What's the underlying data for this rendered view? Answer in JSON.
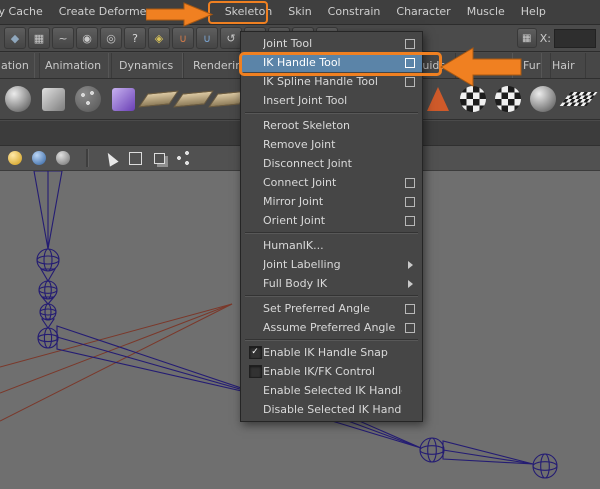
{
  "menu_bar": {
    "items": [
      {
        "label": "ry Cache"
      },
      {
        "label": "Create Deformers"
      },
      {
        "label": "Skeleton",
        "highlighted": true
      },
      {
        "label": "Skin"
      },
      {
        "label": "Constrain"
      },
      {
        "label": "Character"
      },
      {
        "label": "Muscle"
      },
      {
        "label": "Help"
      }
    ]
  },
  "status_line": {
    "coord_label": "X:",
    "coord_value": "",
    "icons": [
      {
        "name": "selection-mask-icon",
        "glyph": "◆",
        "color": "#8fa7bd"
      },
      {
        "name": "snap-grid-icon",
        "glyph": "▦",
        "color": "#c9c9c9"
      },
      {
        "name": "snap-curve-icon",
        "glyph": "~",
        "color": "#c9c9c9"
      },
      {
        "name": "snap-point-icon",
        "glyph": "◉",
        "color": "#c9c9c9"
      },
      {
        "name": "snap-view-icon",
        "glyph": "◎",
        "color": "#c9c9c9"
      },
      {
        "name": "help-icon",
        "glyph": "?",
        "color": "#d8d8d8"
      },
      {
        "name": "lock-icon",
        "glyph": "◈",
        "color": "#d8c35a"
      },
      {
        "name": "magnet-red-icon",
        "glyph": "∪",
        "color": "#d07a4a"
      },
      {
        "name": "magnet-blue-icon",
        "glyph": "∪",
        "color": "#7aa3cf"
      },
      {
        "name": "history-icon",
        "glyph": "↺",
        "color": "#c9c9c9"
      },
      {
        "name": "inputs-list-icon",
        "glyph": "≡",
        "color": "#c9c9c9"
      },
      {
        "name": "render-current-icon",
        "glyph": "▣",
        "color": "#c9c9c9"
      },
      {
        "name": "ipr-render-icon",
        "glyph": "▤",
        "color": "#c9c9c9"
      },
      {
        "name": "render-settings-icon",
        "glyph": "▥",
        "color": "#c9c9c9"
      }
    ]
  },
  "shelf": {
    "tabs": [
      "ation",
      "Animation",
      "Dynamics",
      "Rendering",
      "Fluids",
      "Fur",
      "Hair"
    ],
    "icons": [
      {
        "name": "polygon-sphere-icon",
        "type": "sphere"
      },
      {
        "name": "polygon-cube-icon",
        "type": "cube"
      },
      {
        "name": "particle-tool-icon",
        "type": "particles"
      },
      {
        "name": "polygon-cube-purple-icon",
        "type": "cube-purple"
      },
      {
        "name": "polygon-plane-icon",
        "type": "plane"
      },
      {
        "name": "polygon-plane-2-icon",
        "type": "plane"
      },
      {
        "name": "polygon-plane-3-icon",
        "type": "plane"
      },
      {
        "name": "sculpt-tool-icon",
        "type": "cursor"
      },
      {
        "name": "knife-tool-icon",
        "type": "knife"
      },
      {
        "name": "polygon-plane-4-icon",
        "type": "plane"
      },
      {
        "name": "polygon-plane-5-icon",
        "type": "plane"
      },
      {
        "name": "polygon-cone-icon",
        "type": "cone"
      },
      {
        "name": "joint-cone-icon",
        "type": "cone-red"
      },
      {
        "name": "checker-sphere-icon",
        "type": "checker-sphere"
      },
      {
        "name": "checker-sphere-2-icon",
        "type": "checker-sphere"
      },
      {
        "name": "texture-sphere-icon",
        "type": "sphere"
      },
      {
        "name": "checker-plane-icon",
        "type": "checker-plane"
      }
    ]
  },
  "panel_toolbar": {
    "icons": [
      {
        "name": "shaded-sphere-yellow-icon",
        "type": "sphere-yellow"
      },
      {
        "name": "shaded-sphere-blue-icon",
        "type": "sphere-blue"
      },
      {
        "name": "shaded-sphere-gray-icon",
        "type": "sphere-gray"
      },
      {
        "name": "toolbar-divider",
        "type": "sep"
      },
      {
        "name": "select-tool-icon",
        "type": "cursor"
      },
      {
        "name": "wireframe-cube-icon",
        "type": "cube"
      },
      {
        "name": "layers-icon",
        "type": "layers"
      },
      {
        "name": "connections-icon",
        "type": "share"
      }
    ]
  },
  "skeleton_menu": {
    "items": [
      {
        "label": "Joint Tool",
        "option_box": true
      },
      {
        "label": "IK Handle Tool",
        "option_box": true,
        "highlighted": true
      },
      {
        "label": "IK Spline Handle Tool",
        "option_box": true
      },
      {
        "label": "Insert Joint Tool"
      },
      {
        "separator": true
      },
      {
        "label": "Reroot Skeleton"
      },
      {
        "label": "Remove Joint"
      },
      {
        "label": "Disconnect Joint"
      },
      {
        "label": "Connect Joint",
        "option_box": true
      },
      {
        "label": "Mirror Joint",
        "option_box": true
      },
      {
        "label": "Orient Joint",
        "option_box": true
      },
      {
        "separator": true
      },
      {
        "label": "HumanIK..."
      },
      {
        "label": "Joint Labelling",
        "submenu": true
      },
      {
        "label": "Full Body IK",
        "submenu": true
      },
      {
        "separator": true
      },
      {
        "label": "Set Preferred Angle",
        "option_box": true
      },
      {
        "label": "Assume Preferred Angle",
        "option_box": true
      },
      {
        "separator": true
      },
      {
        "label": "Enable IK Handle Snap",
        "checked": true
      },
      {
        "label": "Enable IK/FK Control",
        "checked": false
      },
      {
        "label": "Enable Selected IK Handles"
      },
      {
        "label": "Disable Selected IK Handles"
      }
    ]
  },
  "colors": {
    "accent_orange": "#f08021",
    "highlight_blue": "#5b84a8",
    "viewport_bg": "#6f6f6f",
    "wireframe_blue": "#241c73",
    "wireframe_red": "#7b382a"
  }
}
